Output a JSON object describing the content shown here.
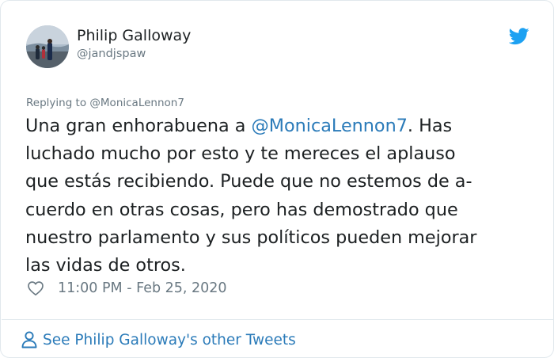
{
  "author": {
    "name": "Philip Galloway",
    "handle": "@jandjspaw"
  },
  "reply": {
    "prefix": "Replying to",
    "to": "@MonicaLennon7"
  },
  "tweet": {
    "lines": [
      {
        "before": "Una gran enhorabuena a ",
        "mention": "@MonicaLennon7",
        "after": ". Has"
      },
      {
        "text": "luchado mucho por esto y te mereces el aplauso"
      },
      {
        "text": "que estás recibiendo. Puede que no estemos de a-"
      },
      {
        "text": "cuerdo en otras cosas, pero has demostrado que"
      },
      {
        "text": "nuestro parlamento y sus políticos pueden mejorar"
      },
      {
        "text": "las vidas de otros."
      }
    ],
    "timestamp": "11:00 PM - Feb 25, 2020"
  },
  "footer": {
    "see_more_label": "See Philip Galloway's other Tweets"
  },
  "icons": {
    "brand": "twitter-bird-icon",
    "like": "heart-icon",
    "profile": "person-icon"
  },
  "colors": {
    "link": "#2b7bb9",
    "twitter_blue": "#1da1f2",
    "secondary_text": "#697882",
    "border": "#e1e8ed"
  }
}
